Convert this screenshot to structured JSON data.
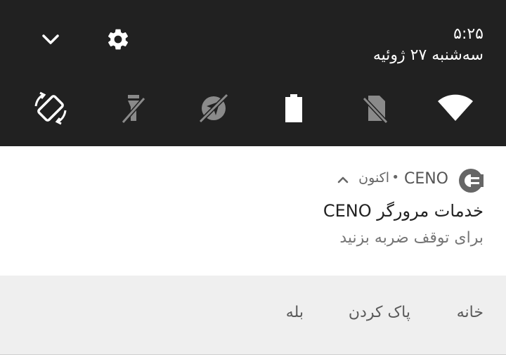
{
  "status": {
    "time": "۵:۲۵",
    "date": "سه‌شنبه ۲۷ ژوئیه"
  },
  "quick_settings": [
    {
      "name": "auto-rotate",
      "icon": "rotate-icon",
      "state": "on"
    },
    {
      "name": "flashlight",
      "icon": "flashlight-off-icon",
      "state": "off"
    },
    {
      "name": "location",
      "icon": "location-off-icon",
      "state": "off"
    },
    {
      "name": "battery",
      "icon": "battery-icon",
      "state": "on"
    },
    {
      "name": "sim",
      "icon": "no-sim-icon",
      "state": "off"
    },
    {
      "name": "wifi",
      "icon": "wifi-icon",
      "state": "on"
    }
  ],
  "notification": {
    "app_name": "CENO",
    "separator": "•",
    "time": "اکنون",
    "title": "خدمات مرورگر CENO",
    "body": "برای توقف ضربه بزنید"
  },
  "actions": {
    "home": "خانه",
    "clear": "پاک کردن",
    "yes": "بله"
  },
  "colors": {
    "shade_bg": "#212121",
    "card_bg": "#ffffff",
    "actions_bg": "#efefef",
    "icon_on": "#ffffff",
    "icon_off": "#8a8a8a"
  }
}
